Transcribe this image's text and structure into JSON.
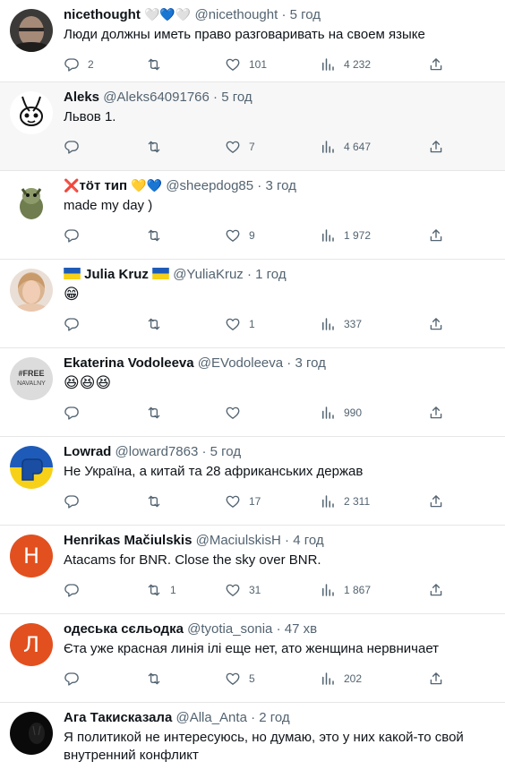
{
  "tweets": [
    {
      "name": "nicethought",
      "emoji": "🤍💙🤍",
      "handle": "@nicethought",
      "time": "5 год",
      "text": "Люди должны иметь право разговаривать на своем языке",
      "replies": "2",
      "retweets": "",
      "likes": "101",
      "views": "4 232",
      "avatar": "photo"
    },
    {
      "name": "Aleks",
      "handle": "@Aleks64091766",
      "time": "5 год",
      "text": "Львов 1.",
      "replies": "",
      "retweets": "",
      "likes": "7",
      "views": "4 647",
      "avatar": "rabbit-drawing"
    },
    {
      "name": "тöт тип",
      "name_prefix": "❌",
      "emoji": "💛💙",
      "handle": "@sheepdog85",
      "time": "3 год",
      "text": "made my day )",
      "replies": "",
      "retweets": "",
      "likes": "9",
      "views": "1 972",
      "avatar": "cartoon-dog"
    },
    {
      "name": "Julia Kruz",
      "flag_before": "ua-flag",
      "flag_after": "ua-flag",
      "handle": "@YuliaKruz",
      "time": "1 год",
      "text": "😁",
      "replies": "",
      "retweets": "",
      "likes": "1",
      "views": "337",
      "avatar": "photo"
    },
    {
      "name": "Ekaterina Vodoleeva",
      "handle": "@EVodoleeva",
      "time": "3 год",
      "text": "😆😆😆",
      "replies": "",
      "retweets": "",
      "likes": "",
      "views": "990",
      "avatar": "free-navalny"
    },
    {
      "name": "Lowrad",
      "handle": "@loward7863",
      "time": "5 год",
      "text": "Не Україна, а китай та 28 африканських держав",
      "replies": "",
      "retweets": "",
      "likes": "17",
      "views": "2 311",
      "avatar": "fist-flag"
    },
    {
      "name": "Henrikas Mačiulskis",
      "handle": "@MaciulskisH",
      "time": "4 год",
      "text": "Atacams for BNR. Close the sky over BNR.",
      "replies": "",
      "retweets": "1",
      "likes": "31",
      "views": "1 867",
      "avatar": "letter",
      "avatar_letter": "H",
      "avatar_color": "#e2501f"
    },
    {
      "name": "одеська сєльодка",
      "handle": "@tyotia_sonia",
      "time": "47 хв",
      "text": "Єта уже красная линія ілі еще нет, ато женщина нервничает",
      "replies": "",
      "retweets": "",
      "likes": "5",
      "views": "202",
      "avatar": "letter",
      "avatar_letter": "Л",
      "avatar_color": "#e2501f"
    },
    {
      "name": "Ага Такисказала",
      "handle": "@Alla_Anta",
      "time": "2 год",
      "text": "Я политикой не интересуюсь, но думаю, это у них какой-то свой внутренний конфликт",
      "replies": "",
      "retweets": "",
      "likes": "",
      "views": "",
      "avatar": "dark-photo"
    }
  ],
  "icons": {
    "reply": "reply-icon",
    "retweet": "retweet-icon",
    "like": "heart-icon",
    "views": "views-icon",
    "share": "share-icon"
  },
  "colors": {
    "text": "#0f1419",
    "muted": "#536471",
    "avatar_orange": "#e2501f",
    "ua_blue": "#1e5bb8",
    "ua_yellow": "#f7d117"
  }
}
